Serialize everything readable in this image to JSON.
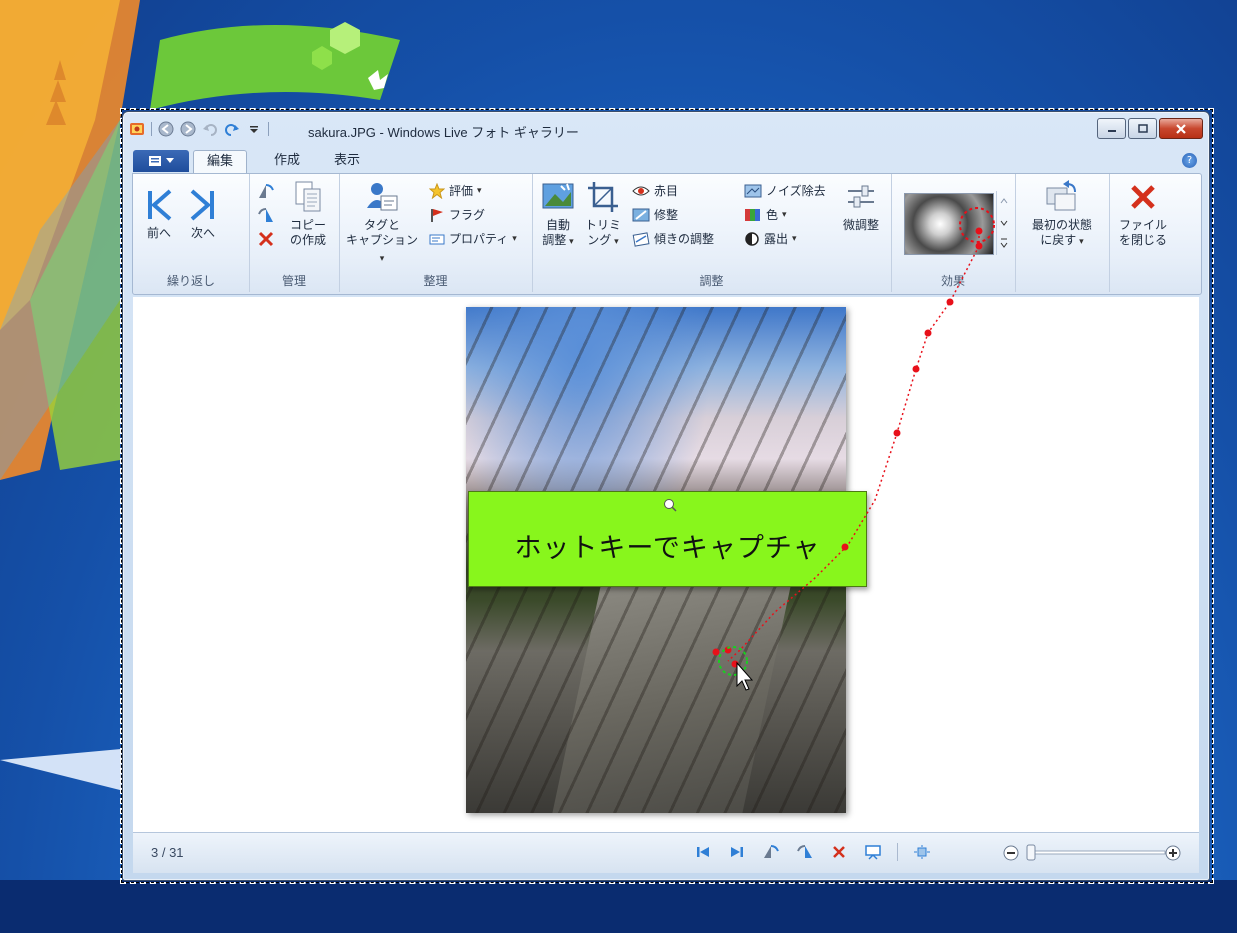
{
  "window": {
    "title": "sakura.JPG - Windows Live フォト ギャラリー"
  },
  "tabs": [
    {
      "label": "編集",
      "active": true
    },
    {
      "label": "作成",
      "active": false
    },
    {
      "label": "表示",
      "active": false
    }
  ],
  "ribbon": {
    "groups": {
      "repeat": {
        "label": "繰り返し",
        "prev": "前へ",
        "next": "次へ"
      },
      "manage": {
        "label": "管理",
        "copy_line1": "コピー",
        "copy_line2": "の作成"
      },
      "organize": {
        "label": "整理",
        "tags_line1": "タグと",
        "tags_line2": "キャプション",
        "rating": "評価",
        "flag": "フラグ",
        "properties": "プロパティ"
      },
      "adjust": {
        "label": "調整",
        "auto_line1": "自動",
        "auto_line2": "調整",
        "trim_line1": "トリミ",
        "trim_line2": "ング",
        "redeye": "赤目",
        "retouch": "修整",
        "straighten": "傾きの調整",
        "noise": "ノイズ除去",
        "color": "色",
        "exposure": "露出",
        "fine_tune": "微調整"
      },
      "effects": {
        "label": "効果"
      },
      "revert": {
        "line1": "最初の状態",
        "line2": "に戻す"
      },
      "close": {
        "line1": "ファイル",
        "line2": "を閉じる"
      }
    }
  },
  "callout": {
    "text": "ホットキーでキャプチャ"
  },
  "statusbar": {
    "counter": "3 / 31"
  },
  "colors": {
    "callout_bg": "#88f61c",
    "accent_blue": "#2a62b6",
    "delete_red": "#d4301c",
    "trail_red": "#e8101a"
  }
}
